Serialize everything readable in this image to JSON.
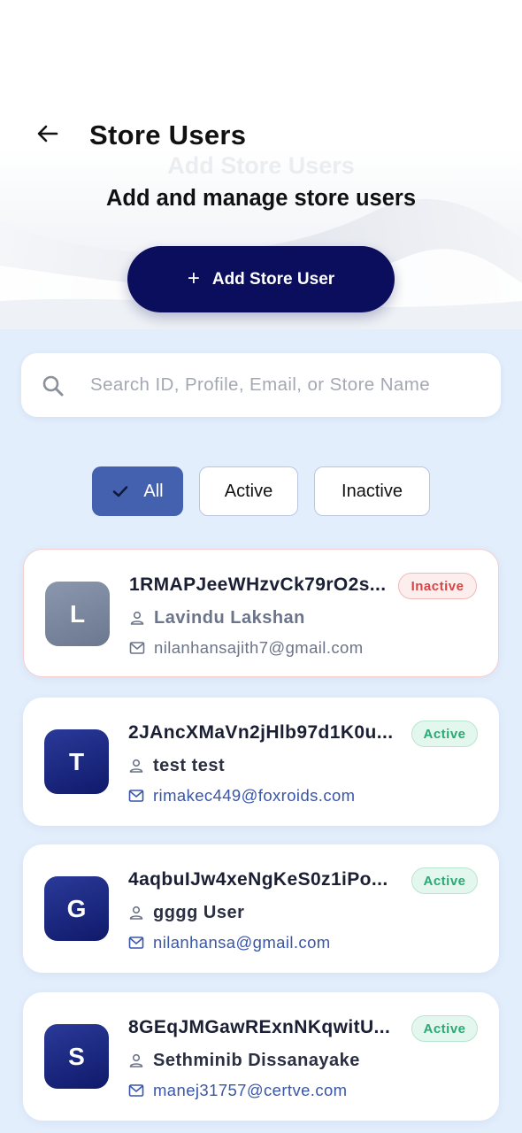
{
  "header": {
    "title": "Store Users",
    "ghost_title": "Add Store Users",
    "subtitle": "Add and manage store users",
    "add_button_label": "Add Store User",
    "back_icon": "arrow-left-icon"
  },
  "search": {
    "placeholder": "Search ID, Profile, Email, or Store Name",
    "value": "",
    "icon": "search-icon"
  },
  "filters": {
    "selected": "All",
    "options": [
      "All",
      "Active",
      "Inactive"
    ]
  },
  "users": [
    {
      "initial": "L",
      "id": "1RMAPJeeWHzvCk79rO2s...",
      "name": "Lavindu Lakshan",
      "email": "nilanhansajith7@gmail.com",
      "status": "Inactive"
    },
    {
      "initial": "T",
      "id": "2JAncXMaVn2jHlb97d1K0u...",
      "name": "test test",
      "email": "rimakec449@foxroids.com",
      "status": "Active"
    },
    {
      "initial": "G",
      "id": "4aqbuIJw4xeNgKeS0z1iPo...",
      "name": "gggg User",
      "email": "nilanhansa@gmail.com",
      "status": "Active"
    },
    {
      "initial": "S",
      "id": "8GEqJMGawRExnNKqwitU...",
      "name": "Sethminib Dissanayake",
      "email": "manej31757@certve.com",
      "status": "Active"
    }
  ],
  "colors": {
    "primary_navy": "#0b0e5c",
    "chip_selected": "#4461b0",
    "page_background": "#e3eefc",
    "active_green": "#2ba874",
    "inactive_red": "#d44545",
    "email_blue": "#3956a8"
  }
}
